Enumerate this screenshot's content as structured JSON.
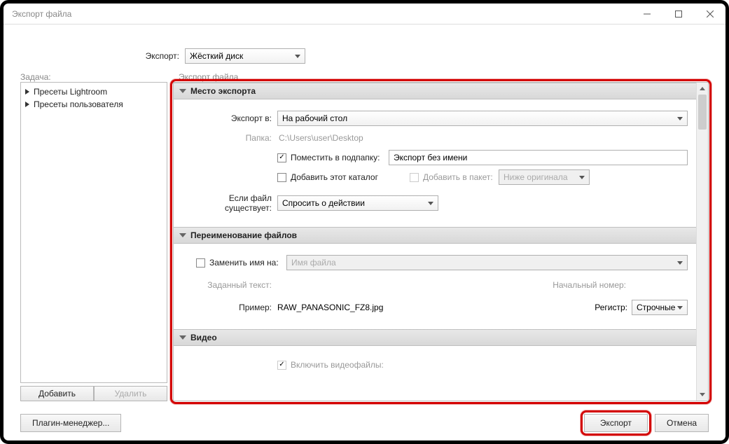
{
  "window": {
    "title": "Экспорт файла"
  },
  "top": {
    "export_label": "Экспорт:",
    "export_value": "Жёсткий диск"
  },
  "sections": {
    "task_label": "Задача:",
    "export_file_label": "Экспорт файла"
  },
  "sidebar": {
    "items": [
      {
        "label": "Пресеты Lightroom"
      },
      {
        "label": "Пресеты пользователя"
      }
    ],
    "add_btn": "Добавить",
    "remove_btn": "Удалить"
  },
  "panel_location": {
    "header": "Место экспорта",
    "export_to_label": "Экспорт в:",
    "export_to_value": "На рабочий стол",
    "folder_label": "Папка:",
    "folder_value": "C:\\Users\\user\\Desktop",
    "put_in_subfolder_label": "Поместить в подпапку:",
    "subfolder_value": "Экспорт без имени",
    "add_catalog_label": "Добавить этот каталог",
    "add_to_batch_label": "Добавить в пакет:",
    "below_original_value": "Ниже оригинала",
    "if_exists_label": "Если файл существует:",
    "if_exists_value": "Спросить о действии"
  },
  "panel_rename": {
    "header": "Переименование файлов",
    "replace_name_label": "Заменить имя на:",
    "template_value": "Имя файла",
    "custom_text_label": "Заданный текст:",
    "start_number_label": "Начальный номер:",
    "example_label": "Пример:",
    "example_value": "RAW_PANASONIC_FZ8.jpg",
    "case_label": "Регистр:",
    "case_value": "Строчные"
  },
  "panel_video": {
    "header": "Видео",
    "include_video_label": "Включить видеофайлы:"
  },
  "footer": {
    "plugin_manager": "Плагин-менеджер...",
    "export_btn": "Экспорт",
    "cancel_btn": "Отмена"
  }
}
